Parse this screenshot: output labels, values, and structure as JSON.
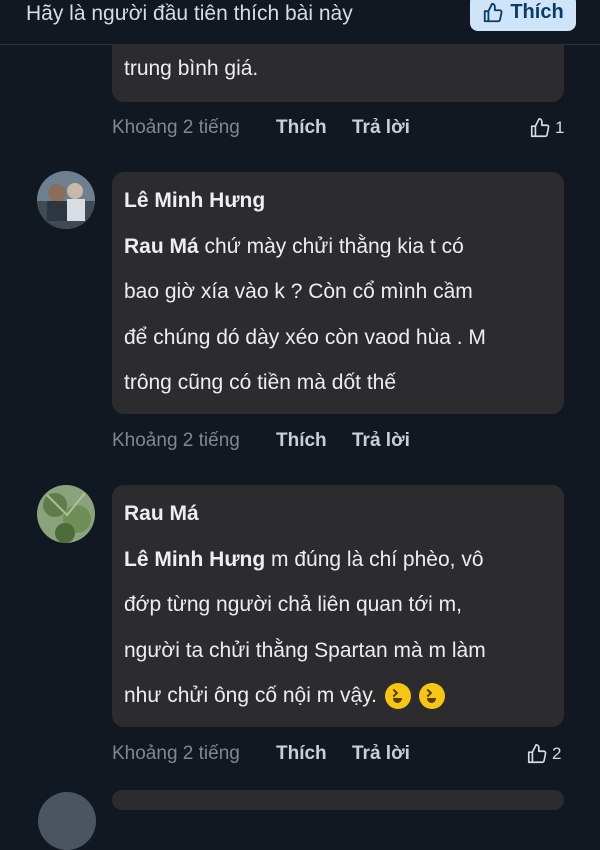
{
  "header": {
    "first_like_text": "Hãy là người đầu tiên thích bài này",
    "like_button": "Thích"
  },
  "comment_prev": {
    "text_tail": "trung bình giá.",
    "time": "Khoảng 2 tiếng",
    "like_label": "Thích",
    "reply_label": "Trả lời",
    "reaction_count": "1"
  },
  "comment_1": {
    "author": "Lê Minh Hưng",
    "mention": "Rau Má",
    "lines": [
      " chứ mày chửi thằng kia t có",
      "bao giờ xía vào k ? Còn cổ mình cầm",
      "để chúng dó dày xéo còn vaod hùa . M",
      "trông cũng có tiền mà dốt thế"
    ],
    "time": "Khoảng 2 tiếng",
    "like_label": "Thích",
    "reply_label": "Trả lời"
  },
  "comment_2": {
    "author": "Rau Má",
    "mention": "Lê Minh Hưng",
    "lines": [
      "  m đúng là chí phèo, vô",
      "đớp từng người chả liên quan tới m,",
      "người ta chửi thằng Spartan mà m làm",
      "như chửi ông cố nội m vậy."
    ],
    "time": "Khoảng 2 tiếng",
    "like_label": "Thích",
    "reply_label": "Trả lời",
    "reaction_count": "2"
  },
  "colors": {
    "background": "#121821",
    "bubble": "#2c2c2e",
    "like_button_bg": "#cfe4f8"
  },
  "icons": [
    "thumbs-up-icon",
    "laughing-emoji-icon"
  ]
}
